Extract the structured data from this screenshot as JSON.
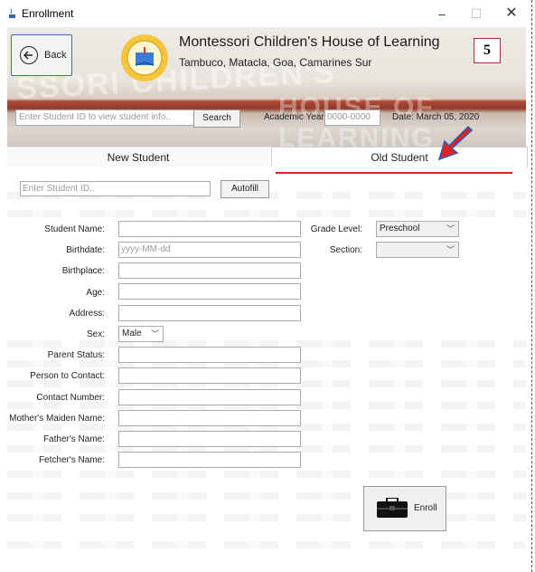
{
  "window": {
    "title": "Enrollment",
    "minimize_glyph": "–",
    "maximize_glyph": "☐",
    "close_glyph": "✕"
  },
  "header": {
    "back_label": "Back",
    "school_name": "Montessori Children's House of Learning",
    "school_address": "Tambuco, Matacla, Goa, Camarines Sur",
    "page_number": "5",
    "banner_text_1": "SSORI CHILDREN'S",
    "banner_text_2": "HOUSE OF LEARNING"
  },
  "search": {
    "placeholder": "Enter Student ID to view student info..",
    "button_label": "Search",
    "academic_year_label": "Academic Year:",
    "academic_year_placeholder": "0000-0000",
    "date_label": "Date:  March 05, 2020"
  },
  "tabs": {
    "new_student": "New Student",
    "old_student": "Old Student"
  },
  "old_student": {
    "student_id_placeholder": "Enter Student ID..",
    "autofill_label": "Autofill"
  },
  "form": {
    "student_name": "Student Name:",
    "birthdate": "Birthdate:",
    "birthdate_placeholder": "yyyy-MM-dd",
    "birthplace": "Birthplace:",
    "age": "Age:",
    "address": "Address:",
    "sex": "Sex:",
    "sex_value": "Male",
    "parent_status": "Parent Status:",
    "person_to_contact": "Person to Contact:",
    "contact_number": "Contact Number:",
    "mothers_maiden_name": "Mother's Maiden Name:",
    "fathers_name": "Father's Name:",
    "fetchers_name": "Fetcher's Name:",
    "grade_level": "Grade Level:",
    "grade_level_value": "Preschool",
    "section": "Section:",
    "section_value": ""
  },
  "enroll": {
    "label": "Enroll"
  },
  "colors": {
    "accent_blue": "#3b6fb8",
    "annotation_red": "#e0241c"
  },
  "icons": {
    "app": "java-cup-icon",
    "back": "back-arrow-icon",
    "logo": "school-logo-icon",
    "enroll": "briefcase-icon",
    "dropdown": "chevron-down-icon"
  }
}
